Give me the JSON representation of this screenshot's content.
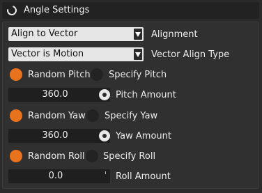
{
  "header": {
    "title": "Angle Settings"
  },
  "alignment": {
    "value": "Align to Vector",
    "label": "Alignment"
  },
  "vector_align": {
    "value": "Vector is Motion",
    "label": "Vector Align Type"
  },
  "pitch": {
    "random_label": "Random Pitch",
    "specify_label": "Specify Pitch",
    "random_selected": true,
    "amount": "360.0",
    "amount_label": "Pitch Amount"
  },
  "yaw": {
    "random_label": "Random Yaw",
    "specify_label": "Specify Yaw",
    "random_selected": true,
    "amount": "360.0",
    "amount_label": "Yaw Amount"
  },
  "roll": {
    "random_label": "Random Roll",
    "specify_label": "Specify Roll",
    "random_selected": true,
    "amount": "0.0",
    "amount_label": "Roll Amount"
  },
  "colors": {
    "accent": "#e8731c",
    "panel": "#303030",
    "field": "#1f1f1f"
  },
  "icons": {
    "header": "refresh-ring-icon",
    "dropdown": "dropdown-arrow-icon",
    "reset": "reset-dot-icon"
  }
}
